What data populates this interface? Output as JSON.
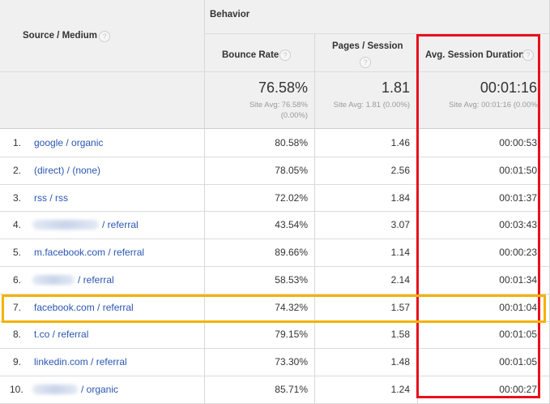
{
  "header": {
    "group": "Behavior",
    "source_medium": "Source / Medium",
    "bounce_rate": "Bounce Rate",
    "pages_session": "Pages / Session",
    "avg_duration": "Avg. Session Duration",
    "help_icon": "?"
  },
  "totals": {
    "bounce_rate": "76.58%",
    "bounce_rate_site_avg_1": "Site Avg: 76.58%",
    "bounce_rate_site_avg_2": "(0.00%)",
    "pages_session": "1.81",
    "pages_session_site_avg": "Site Avg: 1.81 (0.00%)",
    "avg_duration": "00:01:16",
    "avg_duration_site_avg": "Site Avg: 00:01:16 (0.00%)"
  },
  "rows": [
    {
      "num": "1.",
      "source": "google / organic",
      "bounce": "80.58%",
      "pages": "1.46",
      "duration": "00:00:53"
    },
    {
      "num": "2.",
      "source": "(direct) / (none)",
      "bounce": "78.05%",
      "pages": "2.56",
      "duration": "00:01:50"
    },
    {
      "num": "3.",
      "source": "rss / rss",
      "bounce": "72.02%",
      "pages": "1.84",
      "duration": "00:01:37"
    },
    {
      "num": "4.",
      "source": "/ referral",
      "bounce": "43.54%",
      "pages": "3.07",
      "duration": "00:03:43"
    },
    {
      "num": "5.",
      "source": "m.facebook.com / referral",
      "bounce": "89.66%",
      "pages": "1.14",
      "duration": "00:00:23"
    },
    {
      "num": "6.",
      "source": "/ referral",
      "bounce": "58.53%",
      "pages": "2.14",
      "duration": "00:01:34"
    },
    {
      "num": "7.",
      "source": "facebook.com / referral",
      "bounce": "74.32%",
      "pages": "1.57",
      "duration": "00:01:04"
    },
    {
      "num": "8.",
      "source": "t.co / referral",
      "bounce": "79.15%",
      "pages": "1.58",
      "duration": "00:01:05"
    },
    {
      "num": "9.",
      "source": "linkedin.com / referral",
      "bounce": "73.30%",
      "pages": "1.48",
      "duration": "00:01:05"
    },
    {
      "num": "10.",
      "source": "/ organic",
      "bounce": "85.71%",
      "pages": "1.24",
      "duration": "00:00:27"
    }
  ],
  "colors": {
    "link": "#2a57b2",
    "header_bg": "#f0f0f0",
    "highlight_column": "#e8101c",
    "highlight_row": "#f2b300"
  }
}
